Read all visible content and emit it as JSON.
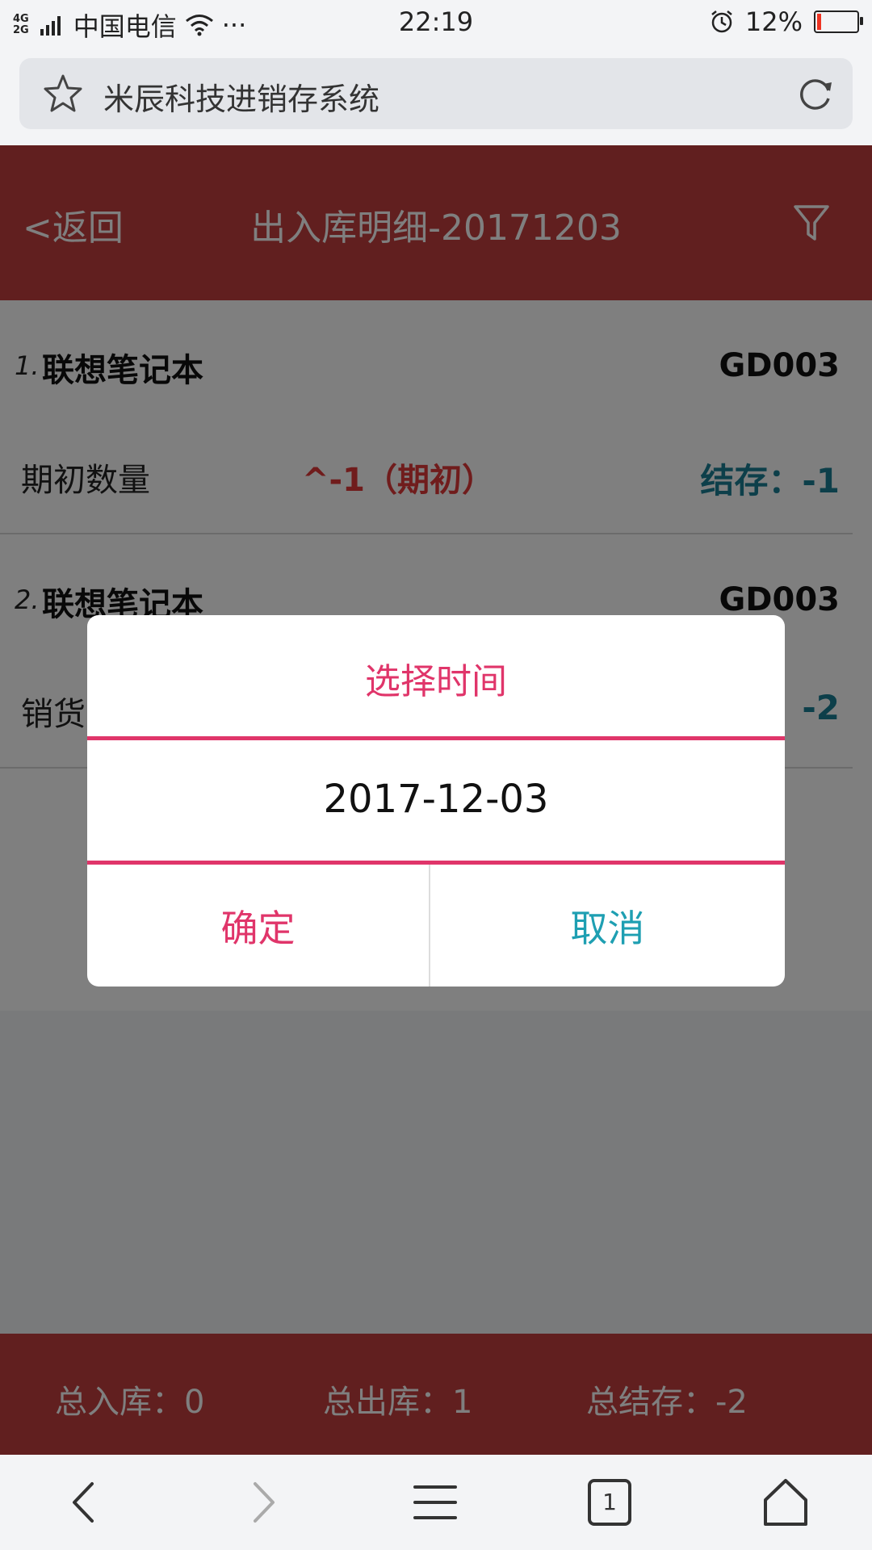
{
  "status_bar": {
    "network_top": "4G",
    "network_bottom": "2G",
    "carrier": "中国电信",
    "more": "···",
    "time": "22:19",
    "battery_percent": "12%",
    "battery_level": 0.12
  },
  "browser": {
    "title": "米辰科技进销存系统",
    "tab_count": "1"
  },
  "header": {
    "back_label": "<返回",
    "title": "出入库明细-20171203"
  },
  "items": [
    {
      "index": "1.",
      "name": "联想笔记本",
      "code": "GD003",
      "type": "期初数量",
      "change": "^-1（期初）",
      "balance": "结存：-1"
    },
    {
      "index": "2.",
      "name": "联想笔记本",
      "code": "GD003",
      "type": "销货",
      "change": "",
      "balance": "-2"
    }
  ],
  "summary": {
    "total_in": "总入库：0",
    "total_out": "总出库：1",
    "total_balance": "总结存：-2"
  },
  "dialog": {
    "title": "选择时间",
    "date": "2017-12-03",
    "confirm_label": "确定",
    "cancel_label": "取消"
  },
  "colors": {
    "header_red": "#c33f3f",
    "accent_pink": "#e0356a",
    "teal": "#1e9fb2",
    "change_red": "#e03838",
    "balance_teal": "#1a7f94"
  }
}
